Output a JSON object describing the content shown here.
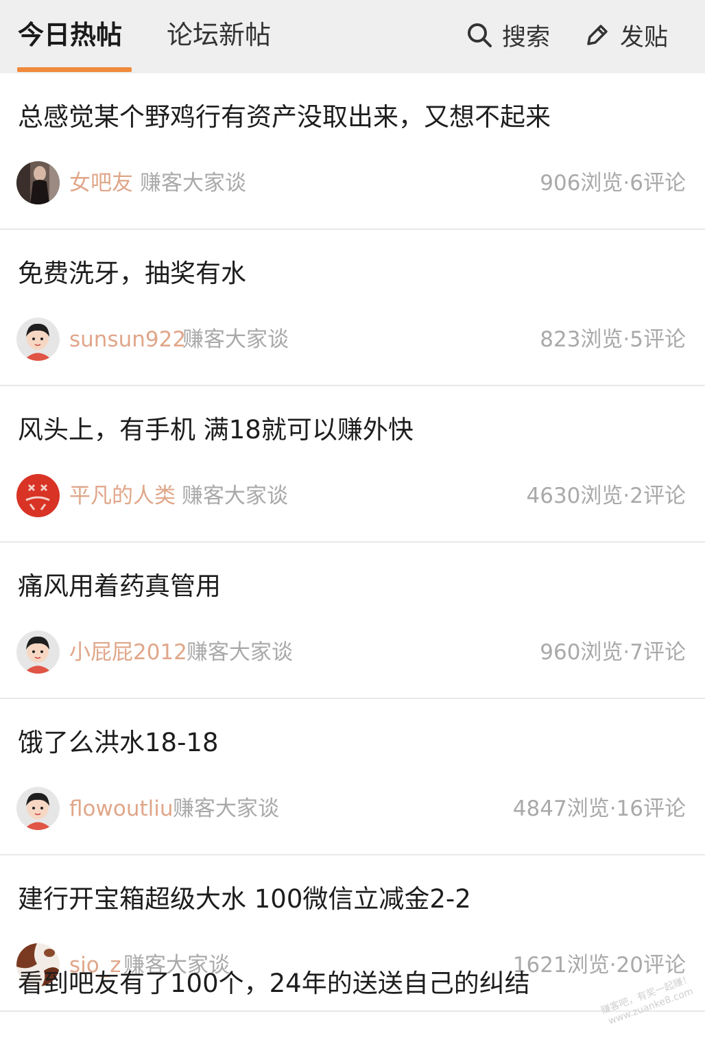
{
  "header": {
    "tabs": [
      {
        "label": "今日热帖",
        "active": true
      },
      {
        "label": "论坛新帖",
        "active": false
      }
    ],
    "search_label": "搜索",
    "post_label": "发贴",
    "accent_color": "#f08a3c"
  },
  "posts": [
    {
      "title": "总感觉某个野鸡行有资产没取出来，又想不起来",
      "author": "女吧友",
      "forum": "赚客大家谈",
      "stats": "906浏览·6评论",
      "avatar": "photo-avatar"
    },
    {
      "title": "免费洗牙，抽奖有水",
      "author": "sunsun922",
      "forum": "赚客大家谈",
      "stats": "823浏览·5评论",
      "avatar": "default-cartoon-avatar"
    },
    {
      "title": "风头上，有手机  满18就可以赚外快",
      "author": "平凡的人类",
      "forum": "赚客大家谈",
      "stats": "4630浏览·2评论",
      "avatar": "red-avatar"
    },
    {
      "title": "痛风用着药真管用",
      "author": "小屁屁2012",
      "forum": "赚客大家谈",
      "stats": "960浏览·7评论",
      "avatar": "default-cartoon-avatar"
    },
    {
      "title": "饿了么洪水18-18",
      "author": "flowoutliu",
      "forum": "赚客大家谈",
      "stats": "4847浏览·16评论",
      "avatar": "default-cartoon-avatar"
    },
    {
      "title": "建行开宝箱超级大水  100微信立减金2-2",
      "author": "sio_z",
      "forum": "赚客大家谈",
      "stats": "1621浏览·20评论",
      "avatar": "cow-pattern-avatar"
    }
  ],
  "partial_post": {
    "title": "看到吧友有了100个，24年的送送自己的纠结"
  },
  "watermark": {
    "line1": "赚客吧，有奖一起赚！",
    "line2": "www.zuanke8.com"
  }
}
